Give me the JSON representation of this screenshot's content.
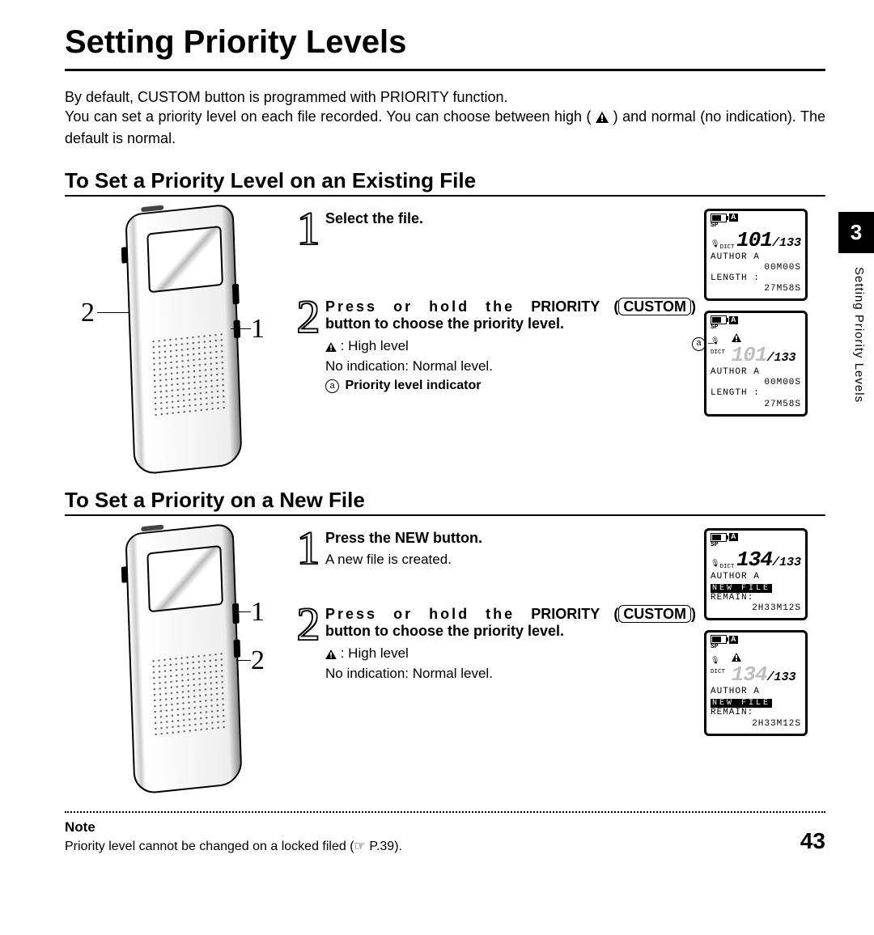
{
  "title": "Setting Priority Levels",
  "intro_line1": "By default, CUSTOM button is programmed with PRIORITY function.",
  "intro_line2_a": "You can set a priority level on each file recorded. You can choose between high ( ",
  "intro_line2_b": " ) and normal (no indication). The default is normal.",
  "section_a_title": "To Set a Priority Level on an Existing File",
  "section_b_title": "To Set a Priority on a New File",
  "step_a1": "Select the file.",
  "step_a2_pre": "Press or hold the ",
  "step_a2_prio": "PRIORITY",
  "step_a2_open": "(",
  "step_a2_custom": "CUSTOM",
  "step_a2_close": ")",
  "step_a2_post": " button to choose the priority level.",
  "detail_high": ": High level",
  "detail_normal": "No indication: Normal level.",
  "detail_indicator": " Priority level indicator",
  "step_b1_bold_a": "Press the ",
  "step_b1_bold_b": "NEW",
  "step_b1_bold_c": " button.",
  "step_b1_detail": "A new file is created.",
  "lcd_a": {
    "sp": "SP",
    "a": "A",
    "mic": "🎤",
    "dict": "DICT",
    "file_num": "101",
    "total": "/133",
    "author": "AUTHOR A",
    "time1": "00M00S",
    "length": "LENGTH :",
    "time2": "27M58S"
  },
  "lcd_b": {
    "file_num": "134",
    "total": "/133",
    "author": "AUTHOR A",
    "newfile": "NEW FILE",
    "remain": "REMAIN:",
    "time": "2H33M12S"
  },
  "callout_a": "a",
  "chapter_num": "3",
  "chapter_label": "Setting Priority Levels",
  "note_head": "Note",
  "note_body": "Priority level cannot be changed on a locked filed (☞ P.39).",
  "page_number": "43",
  "callout_1": "1",
  "callout_2": "2"
}
